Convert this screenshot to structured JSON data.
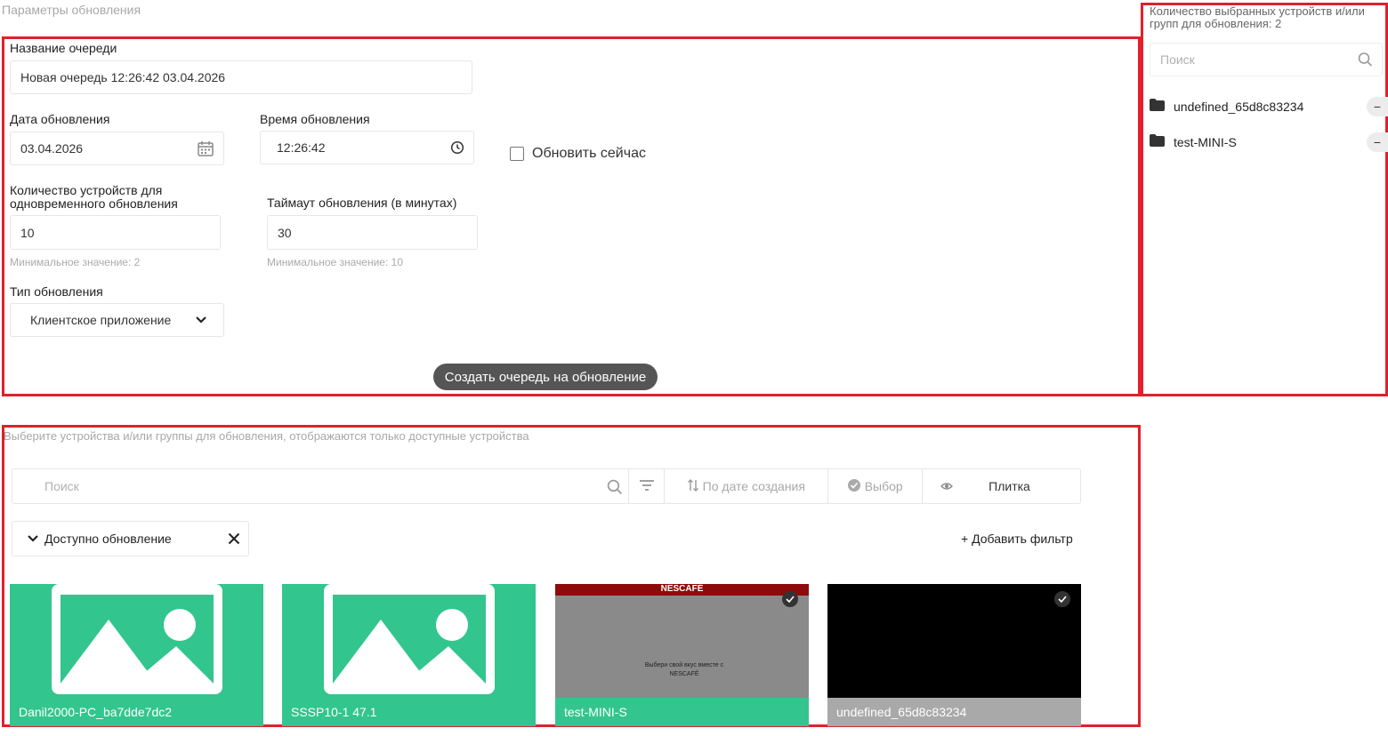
{
  "params": {
    "section_title": "Параметры обновления",
    "queue_name_label": "Название очереди",
    "queue_name_value": "Новая очередь 12:26:42 03.04.2026",
    "date_label": "Дата обновления",
    "date_value": "03.04.2026",
    "time_label": "Время обновления",
    "time_value": "12:26:42",
    "update_now_label": "Обновить сейчас",
    "devices_count_label": "Количество устройств для одновременного обновления",
    "devices_count_value": "10",
    "devices_count_hint": "Минимальное значение: 2",
    "timeout_label": "Таймаут обновления (в минутах)",
    "timeout_value": "30",
    "timeout_hint": "Минимальное значение: 10",
    "update_type_label": "Тип обновления",
    "update_type_value": "Клиентское приложение",
    "create_button": "Создать очередь на обновление"
  },
  "selected": {
    "title": "Количество выбранных устройств и/или групп для обновления: 2",
    "search_placeholder": "Поиск",
    "items": [
      {
        "label": "undefined_65d8c83234",
        "icon": "folder-icon"
      },
      {
        "label": "test-MINI-S",
        "icon": "folder-icon"
      }
    ]
  },
  "devices": {
    "section_title": "Выберите устройства и/или группы для обновления, отображаются только доступные устройства",
    "search_placeholder": "Поиск",
    "sort_label": "По дате создания",
    "select_label": "Выбор",
    "view_label": "Плитка",
    "filter_chip": "Доступно обновление",
    "add_filter": "+ Добавить фильтр",
    "cards": [
      {
        "name": "Danil2000-PC_ba7dde7dc2",
        "selected": false
      },
      {
        "name": "SSSP10-1 47.1",
        "selected": false
      },
      {
        "name": "test-MINI-S",
        "selected": true,
        "preview_brand": "NESCAFÉ",
        "preview_text": "Выбери свой вкус вместе с NESCAFÉ"
      },
      {
        "name": "undefined_65d8c83234",
        "selected": true
      }
    ]
  },
  "colors": {
    "accent_green": "#33c58e",
    "highlight_red": "#e0202a",
    "button_dark": "#555555",
    "caption_gray": "#a9a9a9"
  }
}
